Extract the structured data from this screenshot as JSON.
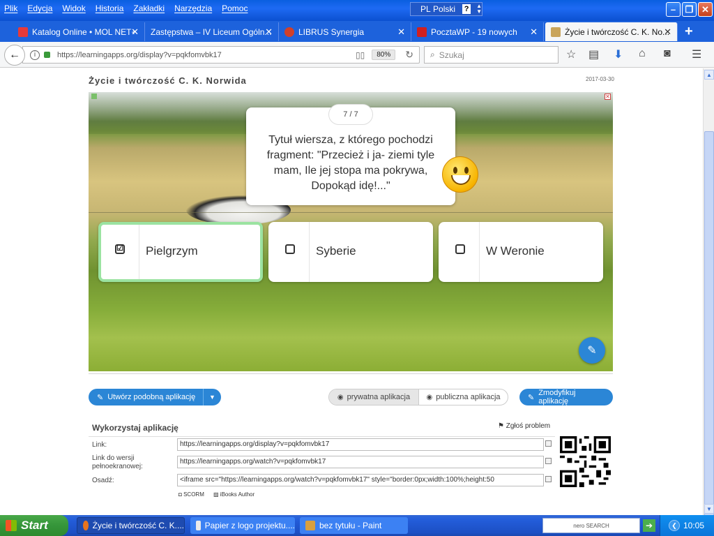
{
  "menu": [
    "Plik",
    "Edycja",
    "Widok",
    "Historia",
    "Zakładki",
    "Narzędzia",
    "Pomoc"
  ],
  "language": {
    "code": "PL",
    "name": "Polski"
  },
  "tabs": [
    {
      "label": "Katalog Online • MOL NET+",
      "icon_color": "#e63a3a"
    },
    {
      "label": "Zastępstwa – IV Liceum Ogóln...",
      "icon_color": "#cccccc"
    },
    {
      "label": "LIBRUS Synergia",
      "icon_color": "#d0402a"
    },
    {
      "label": "PocztaWP - 19 nowych",
      "icon_color": "#d02020"
    },
    {
      "label": "Życie i twórczość C. K. No...",
      "icon_color": "#b08a3a"
    }
  ],
  "nav": {
    "url": "https://learningapps.org/display?v=pqkfomvbk17",
    "zoom": "80%",
    "search_placeholder": "Szukaj"
  },
  "app": {
    "title": "Życie i twórczość C. K. Norwida",
    "date": "2017-03-30",
    "counter": "7 / 7",
    "question": "Tytuł wiersza, z którego pochodzi fragment: \"Przecież i ja- ziemi tyle mam, Ile jej stopa ma pokrywa, Dopokąd idę!...\"",
    "answers": [
      {
        "label": "Pielgrzym",
        "checked": true,
        "mark": "☑"
      },
      {
        "label": "Syberie",
        "checked": false,
        "mark": ""
      },
      {
        "label": "W Weronie",
        "checked": false,
        "mark": ""
      }
    ]
  },
  "actions": {
    "create_label": "Utwórz podobną aplikację",
    "private_label": "prywatna aplikacja",
    "public_label": "publiczna aplikacja",
    "modify_label": "Zmodyfikuj aplikację"
  },
  "use": {
    "title": "Wykorzystaj aplikację",
    "report": "Zgłoś problem",
    "link_label": "Link:",
    "link_value": "https://learningapps.org/display?v=pqkfomvbk17",
    "fullscreen_label": "Link do wersji pełnoekranowej:",
    "fullscreen_value": "https://learningapps.org/watch?v=pqkfomvbk17",
    "embed_label": "Osadź:",
    "embed_value": "<iframe src=\"https://learningapps.org/watch?v=pqkfomvbk17\" style=\"border:0px;width:100%;height:50",
    "scorm": "SCORM",
    "ibooks": "iBooks Author"
  },
  "taskbar": {
    "start": "Start",
    "items": [
      "Życie i twórczość C. K....",
      "Papier z logo projektu....",
      "bez tytułu - Paint"
    ],
    "nero": "nero SEARCH",
    "time": "10:05"
  },
  "colors": {
    "accent": "#2b86d6",
    "selected_border": "#9be3a1",
    "titlebar": "#1e6af3"
  }
}
